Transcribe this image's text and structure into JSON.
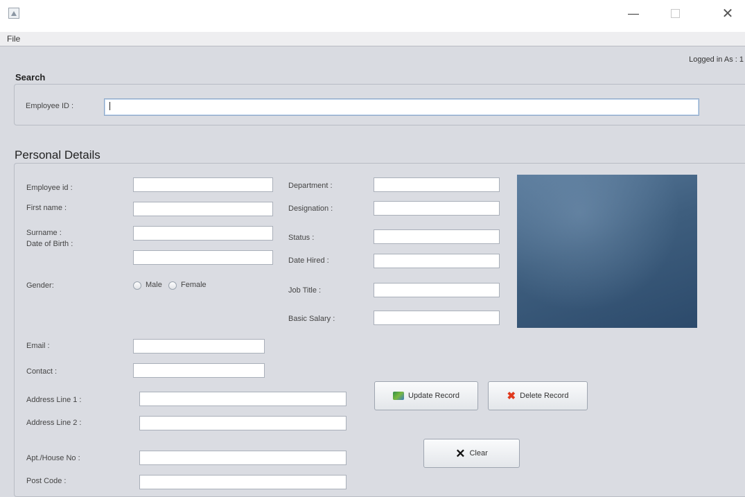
{
  "titlebar": {
    "minimize": "—",
    "close": "✕"
  },
  "menu": {
    "file": "File"
  },
  "status": {
    "logged_in": "Logged in As : 1"
  },
  "search": {
    "title": "Search",
    "employee_id_label": "Employee ID :",
    "employee_id_value": ""
  },
  "personal": {
    "title": "Personal Details",
    "labels": {
      "employee_id": "Employee id :",
      "first_name": "First name :",
      "surname": "Surname :",
      "dob": "Date of Birth :",
      "gender": "Gender:",
      "male": "Male",
      "female": "Female",
      "email": "Email :",
      "contact": "Contact :",
      "address1": "Address Line 1 :",
      "address2": "Address Line 2 :",
      "apt": "Apt./House No :",
      "post_code": "Post Code :",
      "department": "Department :",
      "designation": "Designation :",
      "status": "Status :",
      "date_hired": "Date Hired :",
      "job_title": "Job Title :",
      "basic_salary": "Basic Salary :"
    }
  },
  "buttons": {
    "update": "Update Record",
    "delete": "Delete Record",
    "clear": "Clear"
  },
  "icons": {
    "update": "update-record-icon",
    "delete": "delete-x-icon",
    "clear": "clear-x-icon",
    "close": "close-icon"
  }
}
